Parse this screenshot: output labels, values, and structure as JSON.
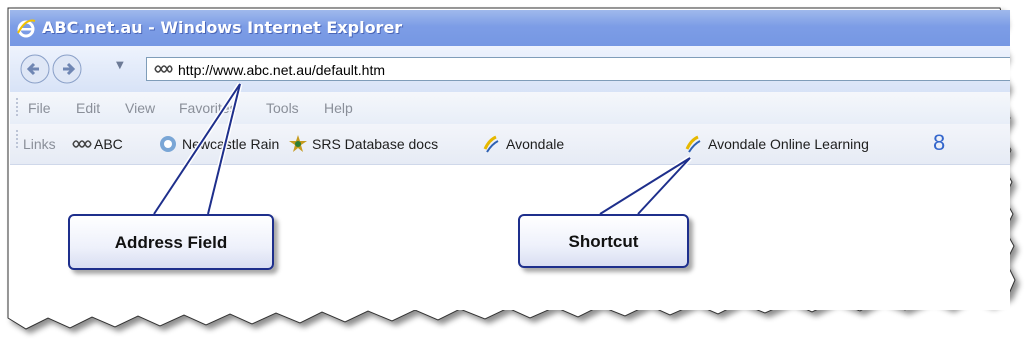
{
  "window": {
    "title": "ABC.net.au - Windows Internet Explorer",
    "url": "http://www.abc.net.au/default.htm"
  },
  "menu": [
    "File",
    "Edit",
    "View",
    "Favorites",
    "Tools",
    "Help"
  ],
  "links_bar": {
    "label": "Links",
    "items": [
      {
        "label": "ABC",
        "icon": "abc-logo-icon"
      },
      {
        "label": "Newcastle Rain",
        "icon": "weather-icon"
      },
      {
        "label": "SRS Database docs",
        "icon": "srs-icon"
      },
      {
        "label": "Avondale",
        "icon": "avondale-icon"
      },
      {
        "label": "Avondale Online Learning",
        "icon": "avondale-icon"
      },
      {
        "label": "8",
        "icon": ""
      }
    ]
  },
  "callouts": {
    "address": "Address Field",
    "shortcut": "Shortcut"
  },
  "colors": {
    "titlebar": "#7d9de6",
    "callout_border": "#1e2f8c",
    "leader_line": "#1e2f8c"
  }
}
